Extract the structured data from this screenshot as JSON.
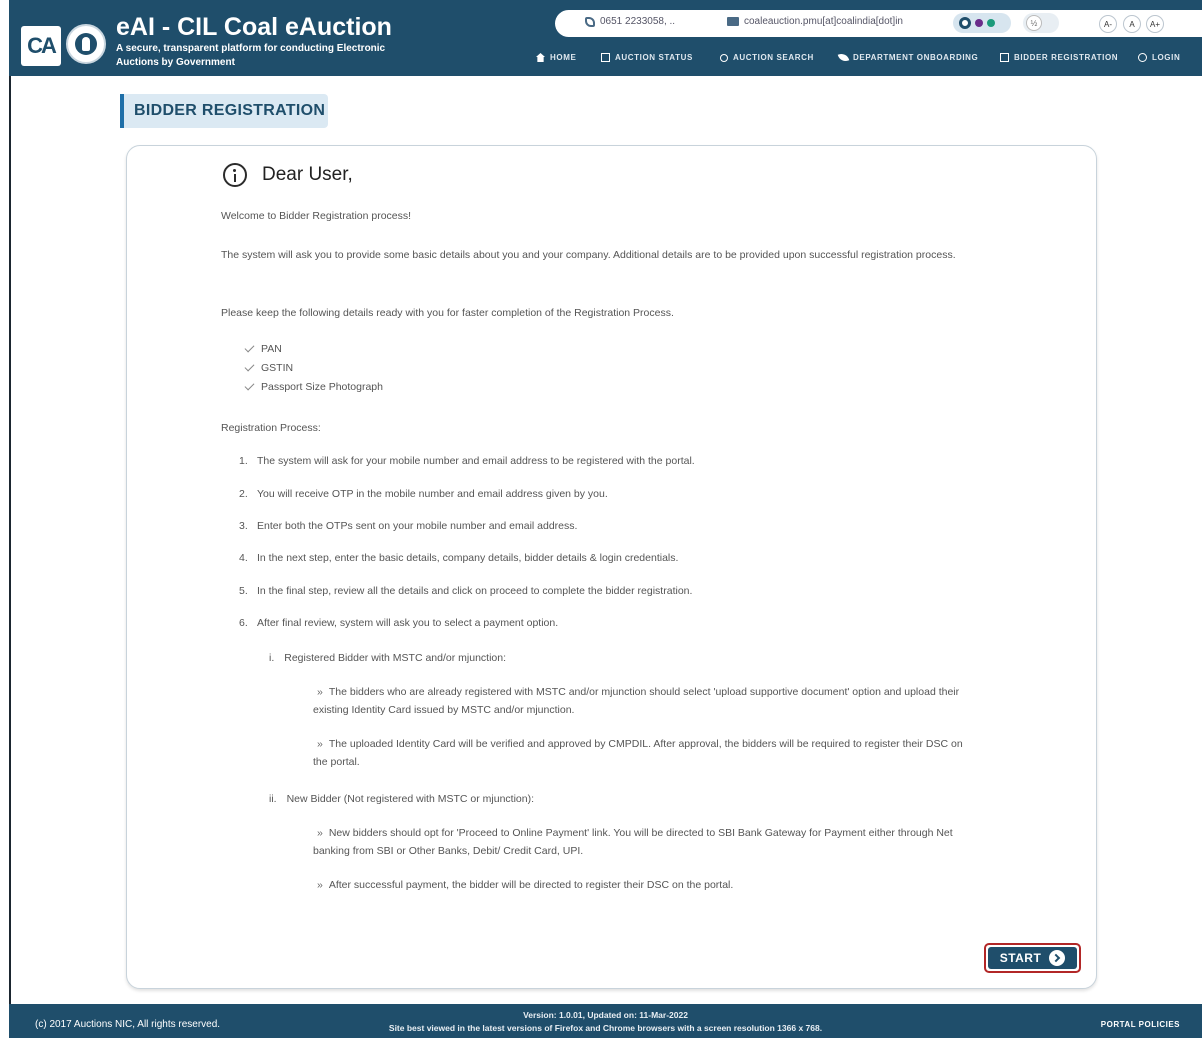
{
  "header": {
    "logo_text": "CA",
    "title": "eAI - CIL Coal eAuction",
    "subtitle": "A secure, transparent platform for conducting Electronic Auctions by Government",
    "phone": "0651 2233058, ..",
    "email": "coaleauction.pmu[at]coalindia[dot]in",
    "contrast_label": "½",
    "font_decrease": "A-",
    "font_normal": "A",
    "font_increase": "A+",
    "theme_colors": [
      "#1f4e6b",
      "#6a2c8a",
      "#1a9a7a"
    ]
  },
  "nav": {
    "home": "HOME",
    "auction_status": "AUCTION STATUS",
    "auction_search": "AUCTION SEARCH",
    "department_onboarding": "DEPARTMENT ONBOARDING",
    "bidder_registration": "BIDDER REGISTRATION",
    "login": "LOGIN"
  },
  "page": {
    "title": "BIDDER REGISTRATION",
    "greeting": "Dear User,",
    "welcome": "Welcome to Bidder Registration process!",
    "intro": "The system will ask you to provide some basic details about you and your company. Additional details are to be provided upon successful registration process.",
    "keep_ready": "Please keep the following details ready with you for faster completion of the Registration Process.",
    "checklist": [
      "PAN",
      "GSTIN",
      "Passport Size Photograph"
    ],
    "process_heading": "Registration Process:",
    "steps": [
      {
        "num": "1.",
        "text": "The system will ask for your mobile number and email address to be registered with the portal."
      },
      {
        "num": "2.",
        "text": "You will receive OTP in the mobile number and email address given by you."
      },
      {
        "num": "3.",
        "text": "Enter both the OTPs sent on your mobile number and email address."
      },
      {
        "num": "4.",
        "text": "In the next step, enter the basic details, company details, bidder details & login credentials."
      },
      {
        "num": "5.",
        "text": "In the final step, review all the details and click on proceed to complete the bidder registration."
      },
      {
        "num": "6.",
        "text": "After final review, system will ask you to select a payment option."
      }
    ],
    "option_i": {
      "num": "i.",
      "label": "Registered Bidder with MSTC and/or mjunction:"
    },
    "option_i_points": [
      "The bidders who are already registered with MSTC and/or mjunction should select 'upload supportive document' option and upload their existing Identity Card issued by MSTC and/or mjunction.",
      "The uploaded Identity Card will be verified and approved by CMPDIL. After approval, the bidders will be required to register their DSC on the portal."
    ],
    "option_ii": {
      "num": "ii.",
      "label": "New Bidder (Not registered with MSTC or mjunction):"
    },
    "option_ii_points": [
      "New bidders should opt for 'Proceed to Online Payment' link. You will be directed to SBI Bank Gateway for Payment either through Net banking from SBI or Other Banks, Debit/ Credit Card, UPI.",
      "After successful payment, the bidder will be directed to register their DSC on the portal."
    ],
    "bullet_mark": "»",
    "start_label": "START"
  },
  "footer": {
    "copyright": "(c) 2017 Auctions NIC, All rights reserved.",
    "version": "Version: 1.0.01, Updated on: 11-Mar-2022",
    "browser_note": "Site best viewed in the latest versions of Firefox and Chrome browsers with a screen resolution 1366 x 768.",
    "policies": "PORTAL POLICIES"
  }
}
